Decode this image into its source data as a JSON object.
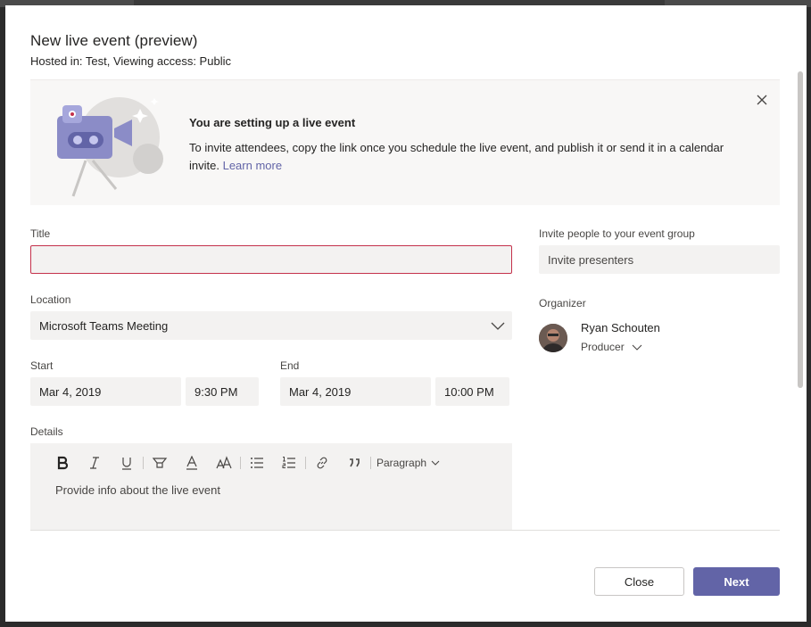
{
  "dialog": {
    "title": "New live event (preview)",
    "subtitle": "Hosted in: Test, Viewing access: Public"
  },
  "banner": {
    "heading": "You are setting up a live event",
    "body": "To invite attendees, copy the link once you schedule the live event, and publish it or send it in a calendar invite.",
    "link": "Learn more"
  },
  "form": {
    "title_label": "Title",
    "title_value": "",
    "location_label": "Location",
    "location_value": "Microsoft Teams Meeting",
    "start_label": "Start",
    "start_date": "Mar 4, 2019",
    "start_time": "9:30 PM",
    "end_label": "End",
    "end_date": "Mar 4, 2019",
    "end_time": "10:00 PM",
    "details_label": "Details",
    "details_placeholder": "Provide info about the live event",
    "paragraph_label": "Paragraph"
  },
  "side": {
    "invite_label": "Invite people to your event group",
    "invite_placeholder": "Invite presenters",
    "organizer_label": "Organizer",
    "organizer_name": "Ryan Schouten",
    "organizer_role": "Producer"
  },
  "footer": {
    "close_label": "Close",
    "next_label": "Next"
  },
  "colors": {
    "accent": "#6264a7",
    "error_border": "#c4314b"
  }
}
